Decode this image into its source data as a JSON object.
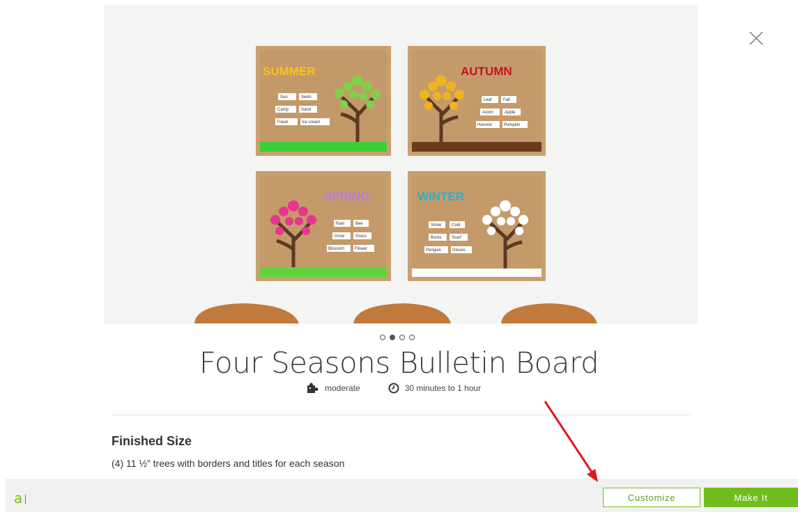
{
  "close_icon": "close-icon",
  "hero": {
    "boards": [
      {
        "title": "SUMMER",
        "words": [
          "Sun",
          "Swim",
          "Camp",
          "Sand",
          "Travel",
          "Ice cream"
        ]
      },
      {
        "title": "AUTUMN",
        "words": [
          "Leaf",
          "Fall",
          "Acorn",
          "Apple",
          "Harvest",
          "Pumpkin"
        ]
      },
      {
        "title": "SPRING",
        "words": [
          "Rain",
          "Bee",
          "Grow",
          "Grass",
          "Blossom",
          "Flower"
        ]
      },
      {
        "title": "WINTER",
        "words": [
          "Snow",
          "Cold",
          "Boots",
          "Scarf",
          "Penguin",
          "Gloves"
        ]
      }
    ]
  },
  "carousel": {
    "count": 4,
    "active_index": 1
  },
  "project": {
    "title": "Four Seasons Bulletin Board",
    "difficulty_icon": "puzzle-icon",
    "difficulty": "moderate",
    "time_icon": "clock-icon",
    "time": "30 minutes to 1 hour"
  },
  "details": {
    "heading": "Finished Size",
    "text": "(4) 11 ½” trees with borders and titles for each season"
  },
  "bottom_bar": {
    "logo": "a",
    "customize_label": "Customize",
    "make_it_label": "Make It"
  },
  "colors": {
    "accent_green": "#71bd1d",
    "annotation_red": "#e3171b"
  }
}
